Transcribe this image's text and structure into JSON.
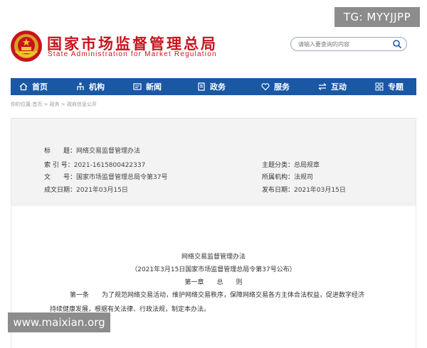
{
  "overlay": {
    "top_right": "TG: MYYJJPP",
    "bottom_left": "www.maixian.org"
  },
  "header": {
    "title": "国家市场监督管理总局",
    "subtitle": "State Administration for Market Regulation",
    "logo_icon": "national-emblem-icon"
  },
  "search": {
    "placeholder": "请输入要查询的内容",
    "icon": "search-icon"
  },
  "nav": {
    "bg_color": "#1a57a4",
    "items": [
      {
        "label": "首页",
        "icon": "home-icon"
      },
      {
        "label": "机构",
        "icon": "org-chart-icon"
      },
      {
        "label": "新闻",
        "icon": "news-icon"
      },
      {
        "label": "政务",
        "icon": "government-affairs-icon"
      },
      {
        "label": "服务",
        "icon": "heart-icon"
      },
      {
        "label": "互动",
        "icon": "interaction-arrows-icon"
      },
      {
        "label": "专题",
        "icon": "topics-grid-icon"
      }
    ]
  },
  "breadcrumb": "你的位置:首页 > 政务 > 政府信息公开",
  "meta": {
    "title_label": "标　　题：",
    "title_value": "网络交易监督管理办法",
    "index_label": "索 引 号：",
    "index_value": "2021-1615800422337",
    "category_label": "主题分类：",
    "category_value": "总局规章",
    "doc_no_label": "文　　号：",
    "doc_no_value": "国家市场监督管理总局令第37号",
    "org_label": "所属机构：",
    "org_value": "法规司",
    "effective_label": "成文日期：",
    "effective_value": "2021年03月15日",
    "publish_label": "发布日期：",
    "publish_value": "2021年03月15日"
  },
  "content": {
    "doc_title": "网络交易监督管理办法",
    "doc_subtitle": "（2021年3月15日国家市场监督管理总局令第37号公布）",
    "chapter": "第一章　　总　　则",
    "article_1_line1": "第一条　　为了规范网络交易活动，维护网络交易秩序，保障网络交易各方主体合法权益，促进数字经济",
    "article_1_line2": "持续健康发展，根据有关法律、行政法规，制定本办法。"
  }
}
